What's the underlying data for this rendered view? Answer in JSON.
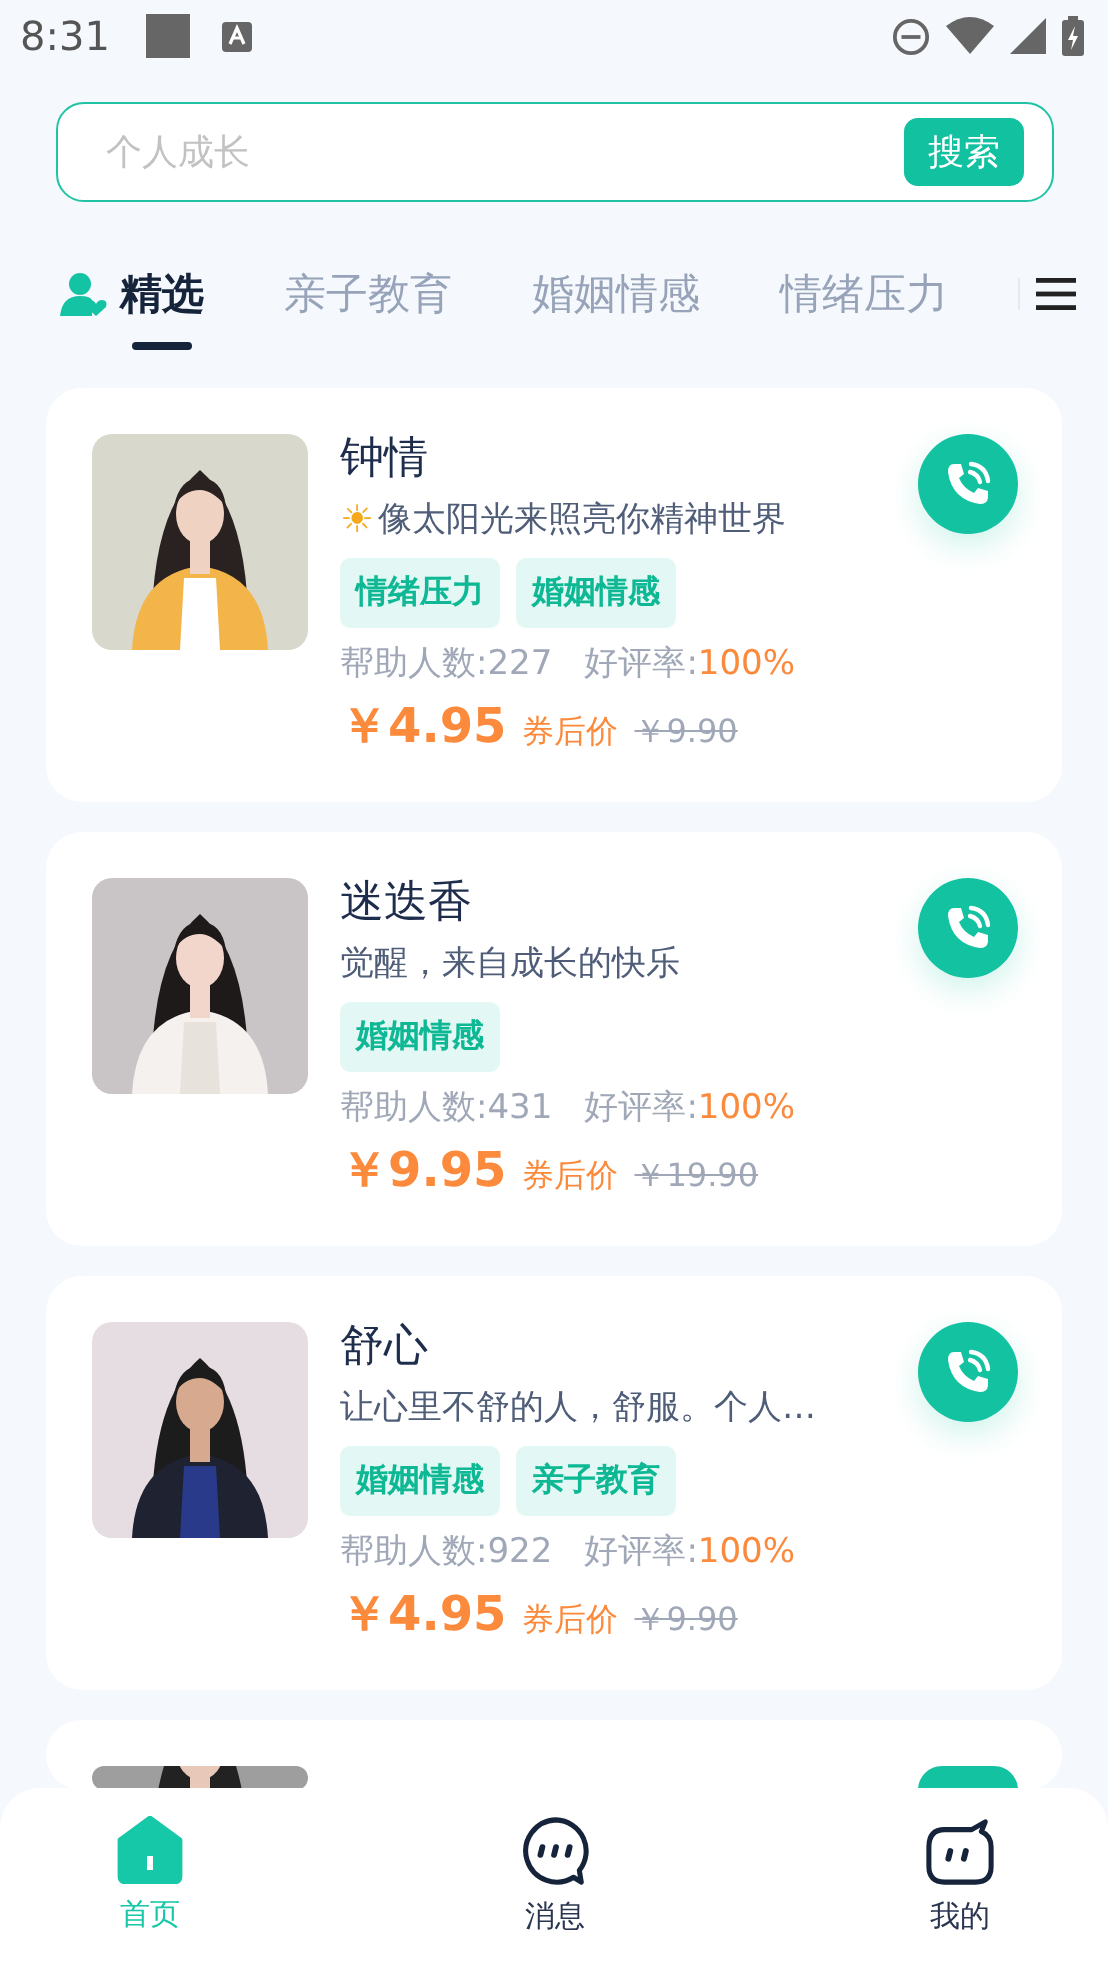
{
  "status_bar": {
    "time": "8:31"
  },
  "search": {
    "placeholder": "个人成长",
    "button": "搜索"
  },
  "tabs": [
    {
      "label": "精选",
      "selected": true
    },
    {
      "label": "亲子教育",
      "selected": false
    },
    {
      "label": "婚姻情感",
      "selected": false
    },
    {
      "label": "情绪压力",
      "selected": false
    }
  ],
  "counselors": [
    {
      "kind": "full",
      "photo": {
        "kind": "picture"
      },
      "name": "钟情",
      "lead_symbol": "☀",
      "motto": "像太阳光来照亮你精神世界",
      "tags": [
        "情绪压力",
        "婚姻情感"
      ],
      "helped": "帮助人数:227",
      "rating_label": "好评率:",
      "rating": "100%",
      "price": "￥4.95",
      "price_note": "券后价",
      "original_price": "￥9.90"
    },
    {
      "kind": "full",
      "photo": {
        "kind": "picture"
      },
      "name": "迷迭香",
      "motto": "觉醒，来自成长的快乐",
      "tags": [
        "婚姻情感"
      ],
      "helped": "帮助人数:431",
      "rating_label": "好评率:",
      "rating": "100%",
      "price": "￥9.95",
      "price_note": "券后价",
      "original_price": "￥19.90"
    },
    {
      "kind": "full",
      "photo": {
        "kind": "picture"
      },
      "name": "舒心",
      "motto": "让心里不舒的人，舒服。个人…",
      "tags": [
        "婚姻情感",
        "亲子教育"
      ],
      "helped": "帮助人数:922",
      "rating_label": "好评率:",
      "rating": "100%",
      "price": "￥4.95",
      "price_note": "券后价",
      "original_price": "￥9.90"
    },
    {
      "kind": "partial",
      "photo": {
        "kind": "picture"
      }
    }
  ],
  "bottom_nav": [
    {
      "label": "首页",
      "selected": true
    },
    {
      "label": "消息",
      "selected": false
    },
    {
      "label": "我的",
      "selected": false
    }
  ]
}
